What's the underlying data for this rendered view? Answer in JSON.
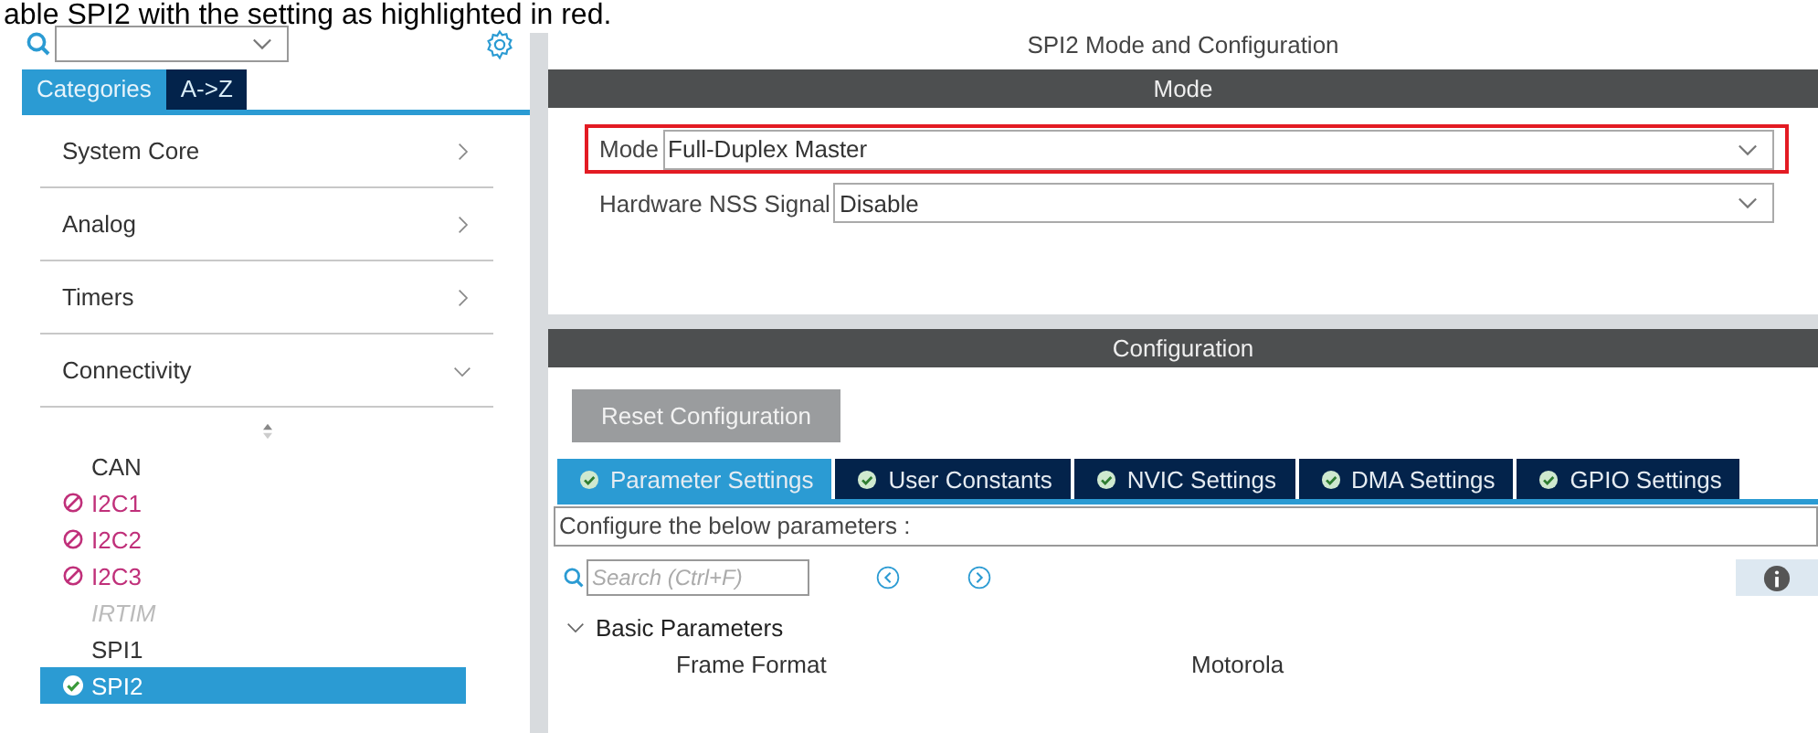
{
  "caption": "able SPI2 with the setting as highlighted in red.",
  "sidebar": {
    "tabs": [
      {
        "label": "Categories",
        "selected": true
      },
      {
        "label": "A->Z",
        "selected": false
      }
    ],
    "categories": [
      {
        "label": "System Core",
        "expanded": false
      },
      {
        "label": "Analog",
        "expanded": false
      },
      {
        "label": "Timers",
        "expanded": false
      },
      {
        "label": "Connectivity",
        "expanded": true,
        "children": [
          {
            "label": "CAN",
            "kind": "plain",
            "selected": false
          },
          {
            "label": "I2C1",
            "kind": "conflict",
            "selected": false
          },
          {
            "label": "I2C2",
            "kind": "conflict",
            "selected": false
          },
          {
            "label": "I2C3",
            "kind": "conflict",
            "selected": false
          },
          {
            "label": "IRTIM",
            "kind": "unavailable",
            "selected": false
          },
          {
            "label": "SPI1",
            "kind": "plain",
            "selected": false
          },
          {
            "label": "SPI2",
            "kind": "enabled",
            "selected": true
          }
        ]
      }
    ]
  },
  "panel": {
    "title": "SPI2 Mode and Configuration",
    "mode": {
      "header": "Mode",
      "fields": [
        {
          "label": "Mode",
          "value": "Full-Duplex Master",
          "highlighted": true
        },
        {
          "label": "Hardware NSS Signal",
          "value": "Disable",
          "highlighted": false
        }
      ]
    },
    "configuration": {
      "header": "Configuration",
      "reset_button": "Reset Configuration",
      "tabs": [
        {
          "label": "Parameter Settings",
          "selected": true
        },
        {
          "label": "User Constants",
          "selected": false
        },
        {
          "label": "NVIC Settings",
          "selected": false
        },
        {
          "label": "DMA Settings",
          "selected": false
        },
        {
          "label": "GPIO Settings",
          "selected": false
        }
      ],
      "hint": "Configure the below parameters :",
      "search": {
        "placeholder": "Search (Ctrl+F)"
      },
      "groups": [
        {
          "label": "Basic Parameters",
          "expanded": true,
          "params": [
            {
              "name": "Frame Format",
              "value": "Motorola"
            }
          ]
        }
      ]
    }
  }
}
